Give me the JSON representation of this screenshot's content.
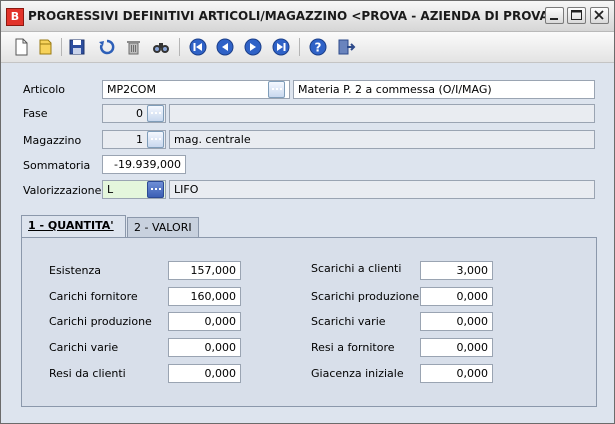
{
  "window": {
    "title": "PROGRESSIVI DEFINITIVI ARTICOLI/MAGAZZINO <PROVA - AZIENDA DI PROVA>",
    "app_icon_letter": "B"
  },
  "toolbar": {
    "buttons": [
      "new-icon",
      "open-icon",
      "save-icon",
      "undo-icon",
      "delete-icon",
      "find-icon",
      "first-icon",
      "prev-icon",
      "next-icon",
      "last-icon",
      "help-icon",
      "exit-icon"
    ]
  },
  "form": {
    "articolo": {
      "label": "Articolo",
      "code": "MP2COM",
      "description": "Materia P. 2 a commessa (O/I/MAG)"
    },
    "fase": {
      "label": "Fase",
      "value": "0",
      "description": ""
    },
    "magazzino": {
      "label": "Magazzino",
      "value": "1",
      "description": "mag. centrale"
    },
    "sommatoria": {
      "label": "Sommatoria",
      "value": "-19.939,000"
    },
    "valorizzazione": {
      "label": "Valorizzazione",
      "value": "L",
      "description": "LIFO"
    }
  },
  "tabs": [
    {
      "label": "1 - QUANTITA'"
    },
    {
      "label": "2 - VALORI"
    }
  ],
  "quantita": {
    "left": [
      {
        "label": "Esistenza",
        "value": "157,000"
      },
      {
        "label": "Carichi fornitore",
        "value": "160,000"
      },
      {
        "label": "Carichi produzione",
        "value": "0,000"
      },
      {
        "label": "Carichi varie",
        "value": "0,000"
      },
      {
        "label": "Resi da clienti",
        "value": "0,000"
      }
    ],
    "right": [
      {
        "label": "Scarichi a clienti",
        "value": "3,000"
      },
      {
        "label": "Scarichi produzione",
        "value": "0,000"
      },
      {
        "label": "Scarichi varie",
        "value": "0,000"
      },
      {
        "label": "Resi a fornitore",
        "value": "0,000"
      },
      {
        "label": "Giacenza iniziale",
        "value": "0,000"
      }
    ]
  },
  "colors": {
    "panel_bg": "#dde4ee",
    "accent_blue": "#3c5fb5",
    "title_icon_red": "#e2332a"
  }
}
